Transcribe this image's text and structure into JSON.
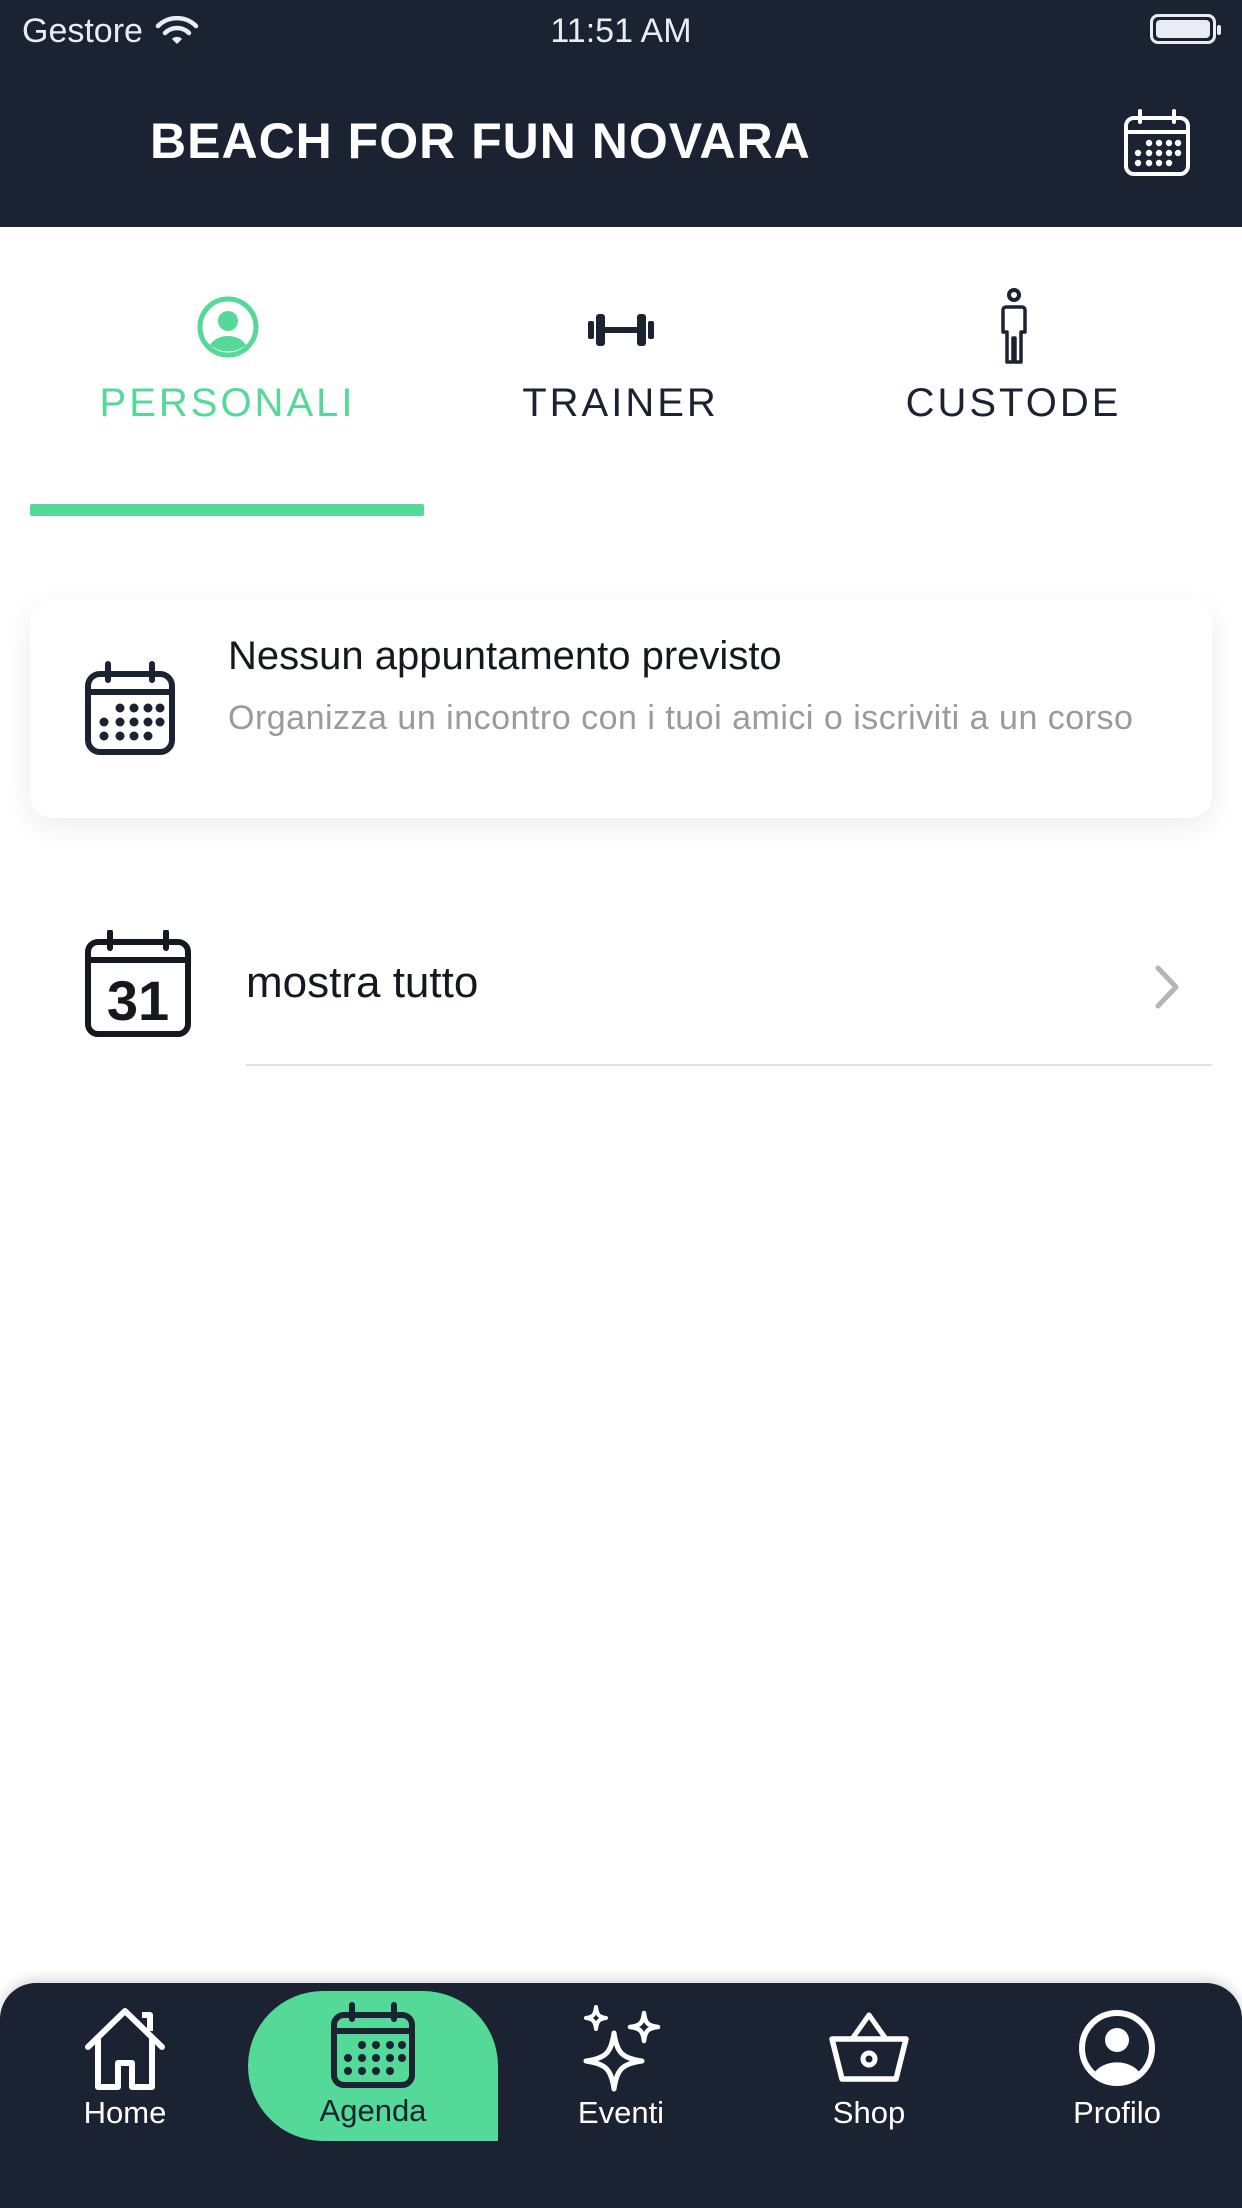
{
  "status_bar": {
    "carrier": "Gestore",
    "time": "11:51 AM"
  },
  "header": {
    "title": "BEACH FOR FUN NOVARA"
  },
  "tabs": [
    {
      "label": "PERSONALI",
      "icon": "user-circle-icon",
      "active": true
    },
    {
      "label": "TRAINER",
      "icon": "dumbbell-icon",
      "active": false
    },
    {
      "label": "CUSTODE",
      "icon": "person-icon",
      "active": false
    }
  ],
  "empty_state": {
    "title": "Nessun appuntamento previsto",
    "subtitle": "Organizza un incontro con i tuoi amici o iscriviti a un corso"
  },
  "show_all": {
    "label": "mostra tutto",
    "calendar_day": "31"
  },
  "bottom_nav": [
    {
      "label": "Home",
      "icon": "home-icon",
      "active": false
    },
    {
      "label": "Agenda",
      "icon": "calendar-icon",
      "active": true
    },
    {
      "label": "Eventi",
      "icon": "sparkles-icon",
      "active": false
    },
    {
      "label": "Shop",
      "icon": "basket-icon",
      "active": false
    },
    {
      "label": "Profilo",
      "icon": "profile-icon",
      "active": false
    }
  ],
  "colors": {
    "dark": "#1b2232",
    "accent": "#55d998",
    "muted_text": "#9a9a9a"
  }
}
